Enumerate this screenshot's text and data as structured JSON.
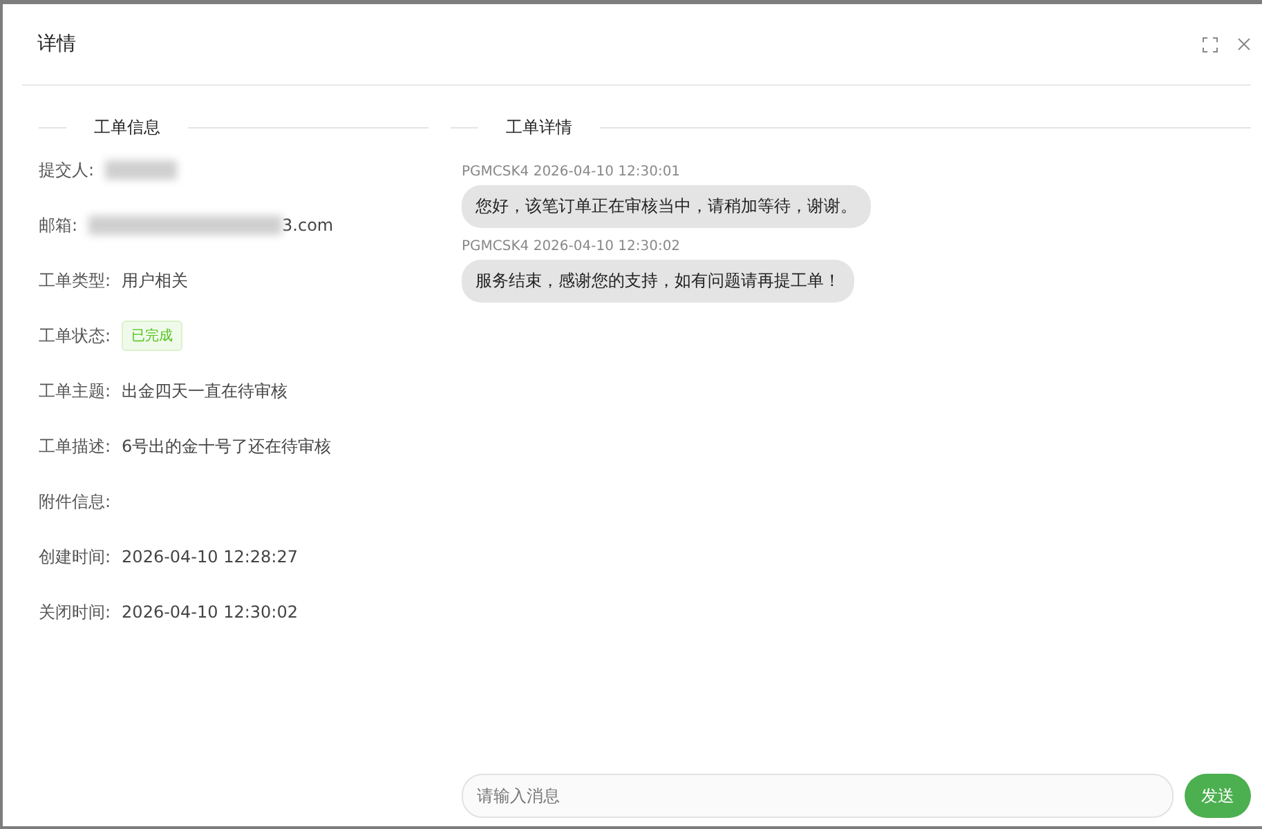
{
  "dialog": {
    "title": "详情"
  },
  "info": {
    "heading": "工单信息",
    "fields": [
      {
        "label": "提交人:",
        "redacted": true
      },
      {
        "label": "邮箱:",
        "kind": "text",
        "redacted": true,
        "value": "3.com"
      },
      {
        "label": "工单类型:",
        "kind": "text",
        "value": "用户相关"
      },
      {
        "label": "工单状态:",
        "kind": "tag",
        "value": "已完成"
      },
      {
        "label": "工单主题:",
        "kind": "text",
        "value": "出金四天一直在待审核"
      },
      {
        "label": "工单描述:",
        "kind": "text",
        "value": "6号出的金十号了还在待审核"
      },
      {
        "label": "附件信息:"
      },
      {
        "label": "创建时间:",
        "kind": "text",
        "value": "2026-04-10 12:28:27"
      },
      {
        "label": "关闭时间:",
        "kind": "text",
        "value": "2026-04-10 12:30:02"
      }
    ]
  },
  "chat": {
    "heading": "工单详情",
    "messages": [
      {
        "meta": "PGMCSK4 2026-04-10 12:30:01",
        "text": "您好，该笔订单正在审核当中，请稍加等待，谢谢。"
      },
      {
        "meta": "PGMCSK4 2026-04-10 12:30:02",
        "text": "服务结束，感谢您的支持，如有问题请再提工单！"
      }
    ],
    "input": {
      "placeholder": "请输入消息"
    },
    "send": "发送"
  }
}
